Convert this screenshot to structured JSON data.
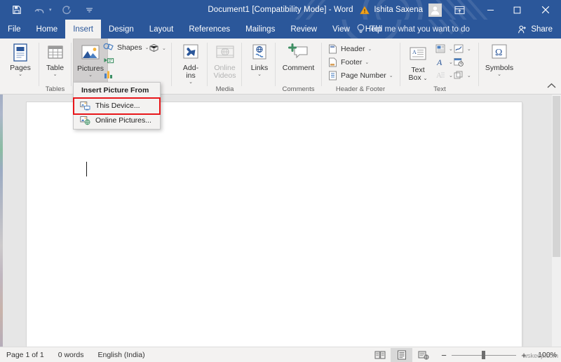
{
  "titlebar": {
    "document_title": "Document1 [Compatibility Mode]  -  Word",
    "account_name": "Ishita Saxena",
    "quick_access": [
      {
        "name": "save-icon",
        "label": "Save"
      },
      {
        "name": "undo-icon",
        "label": "Undo"
      },
      {
        "name": "redo-icon",
        "label": "Redo"
      },
      {
        "name": "customize-qat-icon",
        "label": "Customize Quick Access Toolbar"
      }
    ],
    "warning_icon": "warning-triangle-icon",
    "ribbon_display_options": "ribbon-display-options-icon",
    "minimize": "–",
    "maximize": "□",
    "close": "✕"
  },
  "tabs": [
    {
      "label": "File",
      "active": false
    },
    {
      "label": "Home",
      "active": false
    },
    {
      "label": "Insert",
      "active": true
    },
    {
      "label": "Design",
      "active": false
    },
    {
      "label": "Layout",
      "active": false
    },
    {
      "label": "References",
      "active": false
    },
    {
      "label": "Mailings",
      "active": false
    },
    {
      "label": "Review",
      "active": false
    },
    {
      "label": "View",
      "active": false
    },
    {
      "label": "Help",
      "active": false
    }
  ],
  "tell_me": {
    "label": "Tell me what you want to do",
    "icon": "lightbulb-icon"
  },
  "share": {
    "label": "Share",
    "icon": "share-person-icon"
  },
  "ribbon": {
    "groups": [
      {
        "name": "pages",
        "label": "",
        "buttons": [
          {
            "label": "Pages",
            "caret": "⌄",
            "icon": "pages-icon"
          }
        ]
      },
      {
        "name": "tables",
        "label": "Tables",
        "buttons": [
          {
            "label": "Table",
            "caret": "⌄",
            "icon": "table-icon"
          }
        ]
      },
      {
        "name": "illustrations",
        "label": "",
        "buttons": [
          {
            "label": "Pictures",
            "caret": "⌄",
            "icon": "pictures-icon",
            "selected": true
          }
        ],
        "small_items": [
          {
            "label": "Shapes",
            "icon": "shapes-icon",
            "caret": "⌄"
          },
          {
            "label": "",
            "icon": "icons-3d-model-icon",
            "caret": "⌄"
          },
          {
            "label": "",
            "icon": "smartart-icon",
            "caret": ""
          },
          {
            "label": "",
            "icon": "chart-icon",
            "caret": ""
          }
        ]
      },
      {
        "name": "add-ins",
        "label": "",
        "buttons": [
          {
            "label": "Add-\nins",
            "caret": "⌄",
            "icon": "add-ins-icon"
          }
        ]
      },
      {
        "name": "media",
        "label": "Media",
        "buttons": [
          {
            "label": "Online\nVideos",
            "caret": "",
            "icon": "online-videos-icon",
            "disabled": true
          }
        ]
      },
      {
        "name": "links",
        "label": "",
        "buttons": [
          {
            "label": "Links",
            "caret": "⌄",
            "icon": "links-icon"
          }
        ]
      },
      {
        "name": "comments",
        "label": "Comments",
        "buttons": [
          {
            "label": "Comment",
            "caret": "",
            "icon": "comment-icon"
          }
        ]
      },
      {
        "name": "header-footer",
        "label": "Header & Footer",
        "small_items": [
          {
            "label": "Header",
            "icon": "header-icon",
            "caret": "⌄"
          },
          {
            "label": "Footer",
            "icon": "footer-icon",
            "caret": "⌄"
          },
          {
            "label": "Page Number",
            "icon": "page-number-icon",
            "caret": "⌄"
          }
        ]
      },
      {
        "name": "text",
        "label": "Text",
        "buttons": [
          {
            "label": "Text\nBox",
            "caret": "⌄",
            "icon": "text-box-icon"
          }
        ],
        "small_items": [
          {
            "label": "",
            "icon": "quick-parts-icon",
            "caret": "⌄"
          },
          {
            "label": "",
            "icon": "signature-line-icon",
            "caret": "⌄"
          },
          {
            "label": "",
            "icon": "wordart-icon",
            "caret": "⌄"
          },
          {
            "label": "",
            "icon": "date-time-icon",
            "caret": ""
          },
          {
            "label": "",
            "icon": "drop-cap-icon",
            "caret": "⌄",
            "disabled": true
          },
          {
            "label": "",
            "icon": "object-icon",
            "caret": "⌄"
          }
        ]
      },
      {
        "name": "symbols",
        "label": "",
        "buttons": [
          {
            "label": "Symbols",
            "caret": "⌄",
            "icon": "symbols-omega-icon",
            "glyph": "Ω"
          }
        ]
      }
    ],
    "collapse_icon": "collapse-ribbon-chevron-icon"
  },
  "dropdown": {
    "header": "Insert Picture From",
    "items": [
      {
        "label": "This Device...",
        "icon": "this-device-icon",
        "highlighted": true
      },
      {
        "label": "Online Pictures...",
        "icon": "online-pictures-icon",
        "highlighted": false
      }
    ],
    "highlight_color": "#e8161a"
  },
  "statusbar": {
    "page_info": "Page 1 of 1",
    "word_count": "0 words",
    "language": "English (India)",
    "views": [
      {
        "name": "read-mode-view",
        "active": false
      },
      {
        "name": "print-layout-view",
        "active": true
      },
      {
        "name": "web-layout-view",
        "active": false
      }
    ],
    "zoom_minus": "−",
    "zoom_plus": "+",
    "zoom_level": "100%",
    "watermark": "wskeep.com"
  },
  "colors": {
    "word_blue": "#2b579a",
    "ribbon_bg": "#f3f2f1",
    "doc_bg": "#e6e6e6",
    "highlight_red": "#e8161a"
  }
}
